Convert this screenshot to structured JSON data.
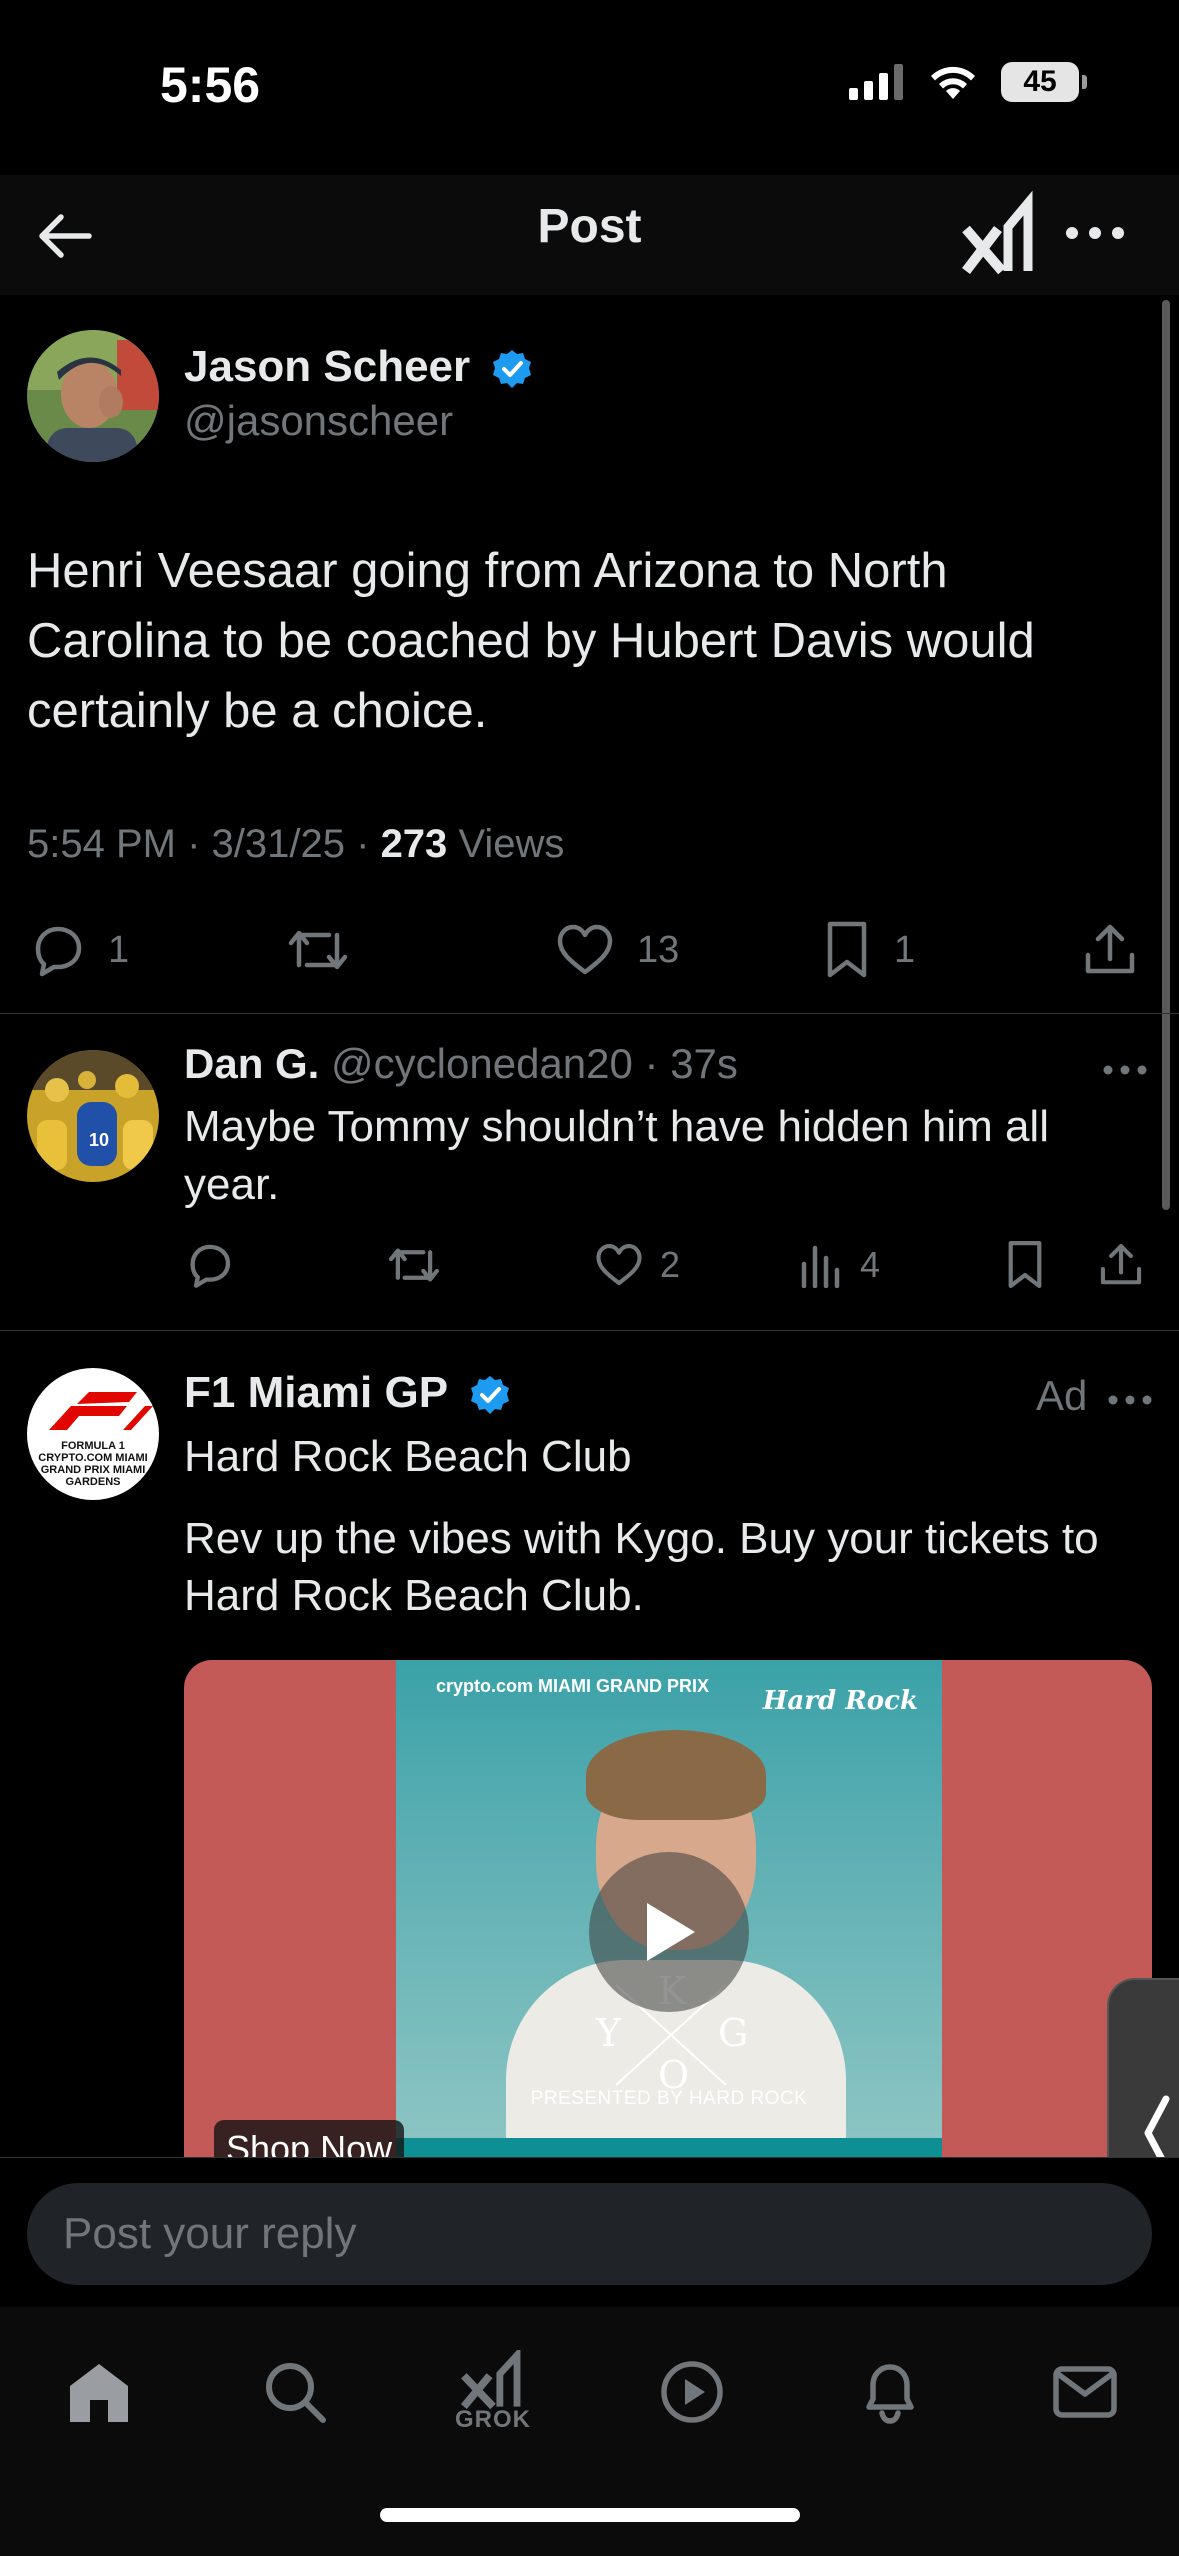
{
  "status_bar": {
    "time": "5:56",
    "battery": "45"
  },
  "header": {
    "title": "Post"
  },
  "main_post": {
    "author_name": "Jason Scheer",
    "author_handle": "@jasonscheer",
    "text": "Henri Veesaar going from Arizona to North Carolina to be coached by Hubert Davis would certainly be a choice.",
    "time": "5:54 PM",
    "date": "3/31/25",
    "views_count": "273",
    "views_label": "Views",
    "replies": "1",
    "likes": "13",
    "bookmarks": "1"
  },
  "reply_post": {
    "author_name": "Dan G.",
    "author_handle": "@cyclonedan20",
    "time": "37s",
    "text": "Maybe Tommy shouldn’t have hidden him all year.",
    "likes": "2",
    "views": "4"
  },
  "ad_post": {
    "author_name": "F1 Miami GP",
    "ad_label": "Ad",
    "subtitle": "Hard Rock Beach Club",
    "text": "Rev up the vibes with Kygo. Buy your tickets to Hard Rock Beach Club.",
    "logo_text": "FORMULA 1 CRYPTO.COM MIAMI GRAND PRIX MIAMI GARDENS",
    "media": {
      "top_text": "crypto.com MIAMI GRAND PRIX",
      "brand": "Hard Rock",
      "kygo_letters": [
        "K",
        "Y",
        "G",
        "O"
      ],
      "presented": "PRESENTED BY HARD ROCK",
      "cta": "Shop Now"
    }
  },
  "reply_bar": {
    "placeholder": "Post your reply"
  },
  "tabbar": {
    "grok_label": "GROK"
  },
  "colors": {
    "accent_blue": "#1d9bf0",
    "muted": "#71767b",
    "text": "#e7e9ea"
  }
}
